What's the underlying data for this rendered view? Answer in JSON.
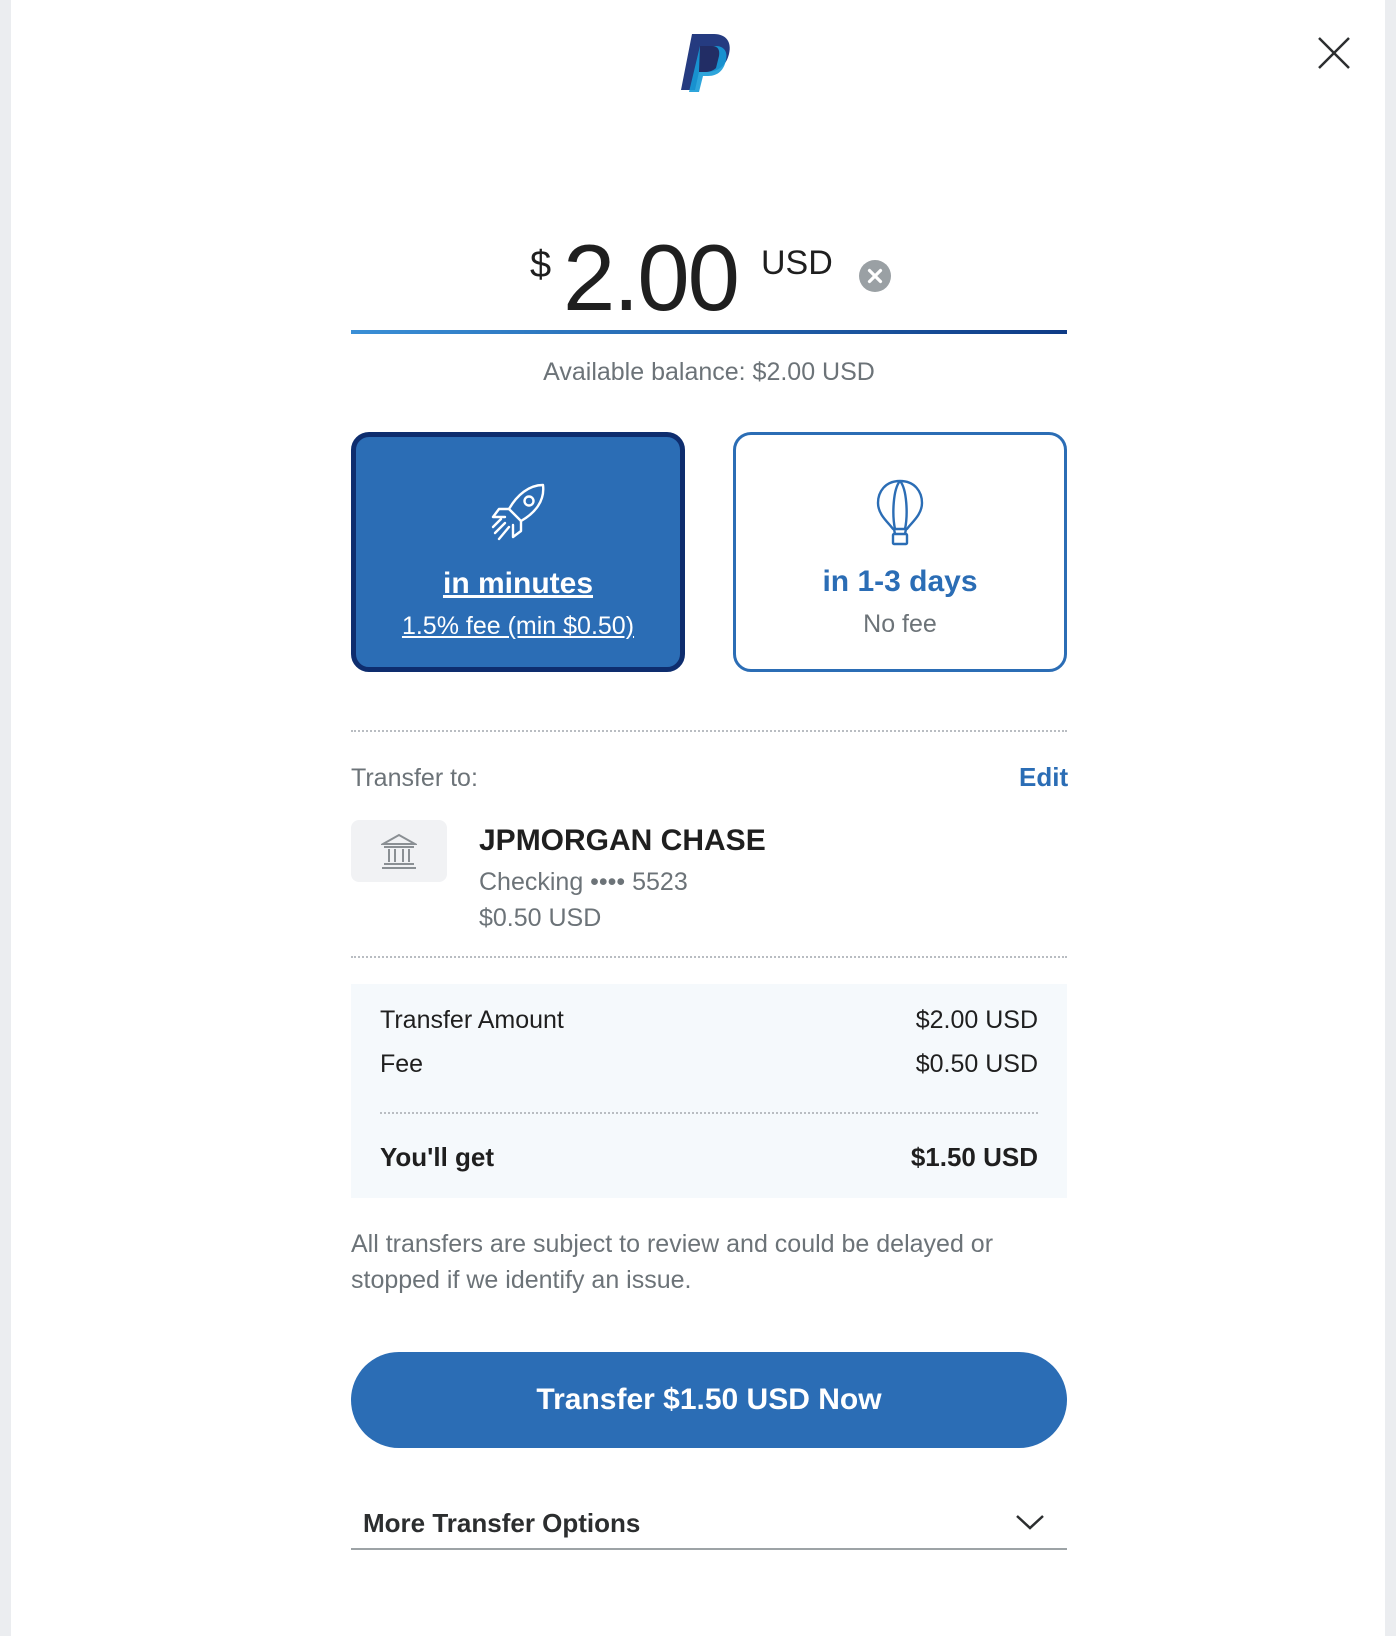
{
  "brand": {
    "logo_icon": "paypal-logo-icon",
    "primary_color": "#2b6db5",
    "dark_color": "#0e2d6e"
  },
  "header": {
    "close_icon": "close-icon"
  },
  "amount": {
    "currency_symbol": "$",
    "value": "2.00",
    "currency_code": "USD",
    "clear_icon": "clear-circle-icon"
  },
  "balance": {
    "text": "Available balance: $2.00 USD"
  },
  "speed_options": [
    {
      "icon": "rocket-icon",
      "title": "in minutes",
      "subtitle": "1.5% fee (min $0.50)",
      "selected": true
    },
    {
      "icon": "hot-air-balloon-icon",
      "title": "in 1-3 days",
      "subtitle": "No fee",
      "selected": false
    }
  ],
  "transfer_to": {
    "label": "Transfer to:",
    "edit_label": "Edit",
    "bank": {
      "icon": "bank-icon",
      "name": "JPMORGAN CHASE",
      "account": "Checking •••• 5523",
      "amount": "$0.50 USD"
    }
  },
  "summary": {
    "rows": [
      {
        "label": "Transfer Amount",
        "value": "$2.00 USD"
      },
      {
        "label": "Fee",
        "value": "$0.50 USD"
      }
    ],
    "total": {
      "label": "You'll get",
      "value": "$1.50 USD"
    }
  },
  "disclaimer": "All transfers are subject to review and could be delayed or stopped if we identify an issue.",
  "cta": {
    "label": "Transfer $1.50 USD Now"
  },
  "more_options": {
    "label": "More Transfer Options",
    "icon": "chevron-down-icon"
  }
}
